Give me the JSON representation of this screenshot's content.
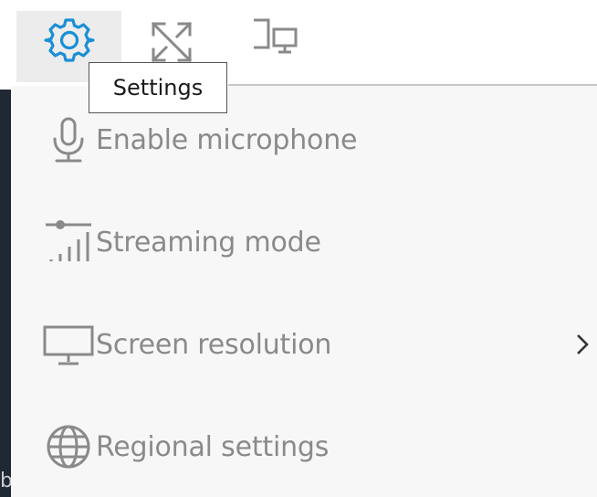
{
  "toolbar": {
    "settings_icon": "gear-icon",
    "fullscreen_icon": "expand-arrows-icon",
    "devices_icon": "devices-icon"
  },
  "tooltip": {
    "text": "Settings"
  },
  "menu": {
    "items": [
      {
        "label": "Enable microphone",
        "icon": "microphone-icon"
      },
      {
        "label": "Streaming mode",
        "icon": "streaming-signal-icon"
      },
      {
        "label": "Screen resolution",
        "icon": "monitor-icon",
        "has_submenu": true
      },
      {
        "label": "Regional settings",
        "icon": "globe-icon"
      }
    ]
  },
  "background": {
    "edge_text": "b"
  },
  "colors": {
    "accent": "#1a8fd6",
    "icon_gray": "#8a8a8a",
    "menu_bg": "#f7f7f7",
    "toolbar_active_bg": "#ececec"
  }
}
